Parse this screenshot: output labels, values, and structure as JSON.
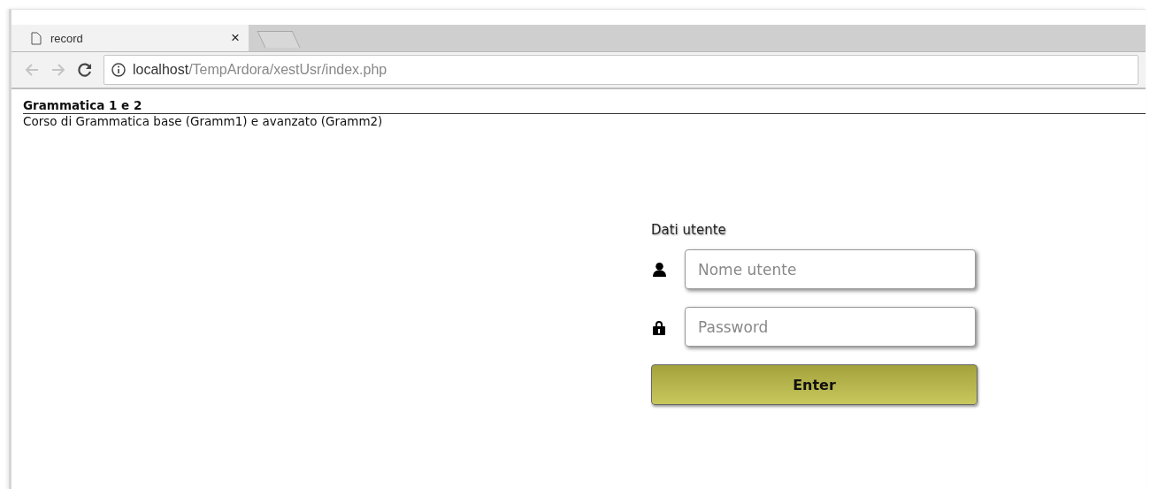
{
  "tab": {
    "title": "record",
    "close": "×"
  },
  "address_bar": {
    "host": "localhost",
    "path": "/TempArdora/xestUsr/index.php"
  },
  "page": {
    "title": "Grammatica 1 e 2",
    "subtitle": "Corso di Grammatica base (Gramm1) e avanzato (Gramm2)"
  },
  "login": {
    "heading": "Dati utente",
    "fields": [
      {
        "kind": "user",
        "placeholder": "Nome utente"
      },
      {
        "kind": "password",
        "placeholder": "Password"
      }
    ],
    "button": "Enter"
  }
}
